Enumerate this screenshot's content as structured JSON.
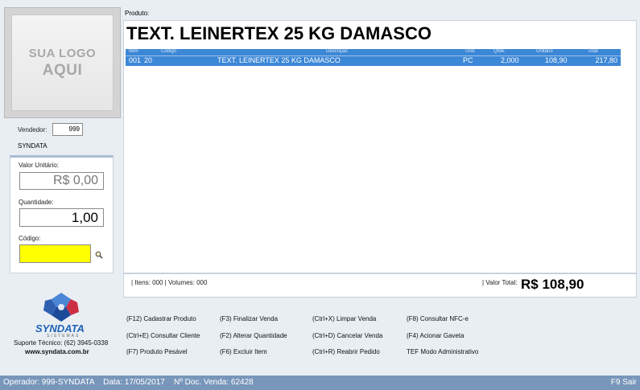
{
  "logo": {
    "line1": "SUA LOGO",
    "line2": "AQUI"
  },
  "vendedor": {
    "label": "Vendedor:",
    "value": "999",
    "name": "SYNDATA"
  },
  "fields": {
    "valor_unitario_label": "Valor Unitário:",
    "valor_unitario_value": "R$ 0,00",
    "quantidade_label": "Quantidade:",
    "quantidade_value": "1,00",
    "codigo_label": "Código:",
    "codigo_value": ""
  },
  "produto": {
    "label": "Produto:",
    "title": "TEXT. LEINERTEX 25 KG DAMASCO"
  },
  "grid": {
    "headers": {
      "item": "Item",
      "codigo": "Código",
      "descricao": "Descrição",
      "und": "Und.",
      "qtde": "Qtde.",
      "unitario": "Unitário",
      "total": "Total"
    },
    "rows": [
      {
        "item": "001",
        "codigo": "20",
        "descricao": "TEXT. LEINERTEX 25 KG DAMASCO",
        "und": "PC",
        "qtde": "2,000",
        "unitario": "108,90",
        "total": "217,80"
      }
    ]
  },
  "footer": {
    "items_text": "| Itens: 000 | Volumes: 000",
    "total_label": "| Valor Total:",
    "total_value": "R$ 108,90"
  },
  "brand": {
    "name": "SYNDATA",
    "sub": "SISTEMAS",
    "support": "Suporte Técnico: (62) 3945-0338",
    "website": "www.syndata.com.br"
  },
  "shortcuts": {
    "col1": [
      "(F12) Cadastrar Produto",
      "(Ctrl+E) Consultar Cliente",
      "(F7) Produto Pesável"
    ],
    "col2": [
      "(F3) Finalizar Venda",
      "(F2) Alterar Quantidade",
      "(F6) Excluir Item"
    ],
    "col3": [
      "(Ctrl+X) Limpar Venda",
      "(Ctrl+D) Cancelar Venda",
      "(Ctrl+R) Reabrir Pedido"
    ],
    "col4": [
      "(F8) Consultar NFC-e",
      "(F4) Acionar Gaveta",
      "TEF Modo Administrativo"
    ]
  },
  "status": {
    "left": "Operador: 999-SYNDATA    Data: 17/05/2017    Nº Doc. Venda: 62428",
    "right": "F9 Sair"
  },
  "colors": {
    "accent": "#3c87d6",
    "status_bar": "#7896ba",
    "codigo_field": "#ffff00",
    "brand": "#1e63b7"
  }
}
